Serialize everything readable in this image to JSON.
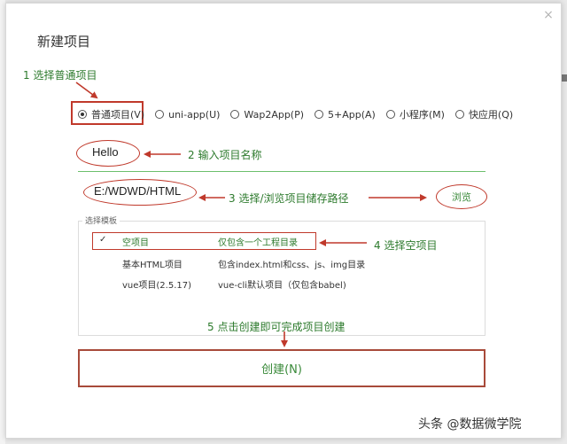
{
  "dialog": {
    "title": "新建项目",
    "close_symbol": "×"
  },
  "project_types": [
    {
      "label": "普通项目(V)",
      "checked": true
    },
    {
      "label": "uni-app(U)",
      "checked": false
    },
    {
      "label": "Wap2App(P)",
      "checked": false
    },
    {
      "label": "5+App(A)",
      "checked": false
    },
    {
      "label": "小程序(M)",
      "checked": false
    },
    {
      "label": "快应用(Q)",
      "checked": false
    }
  ],
  "form": {
    "project_name": "Hello",
    "project_path": "E:/WDWD/HTML",
    "browse_label": "浏览"
  },
  "templates": {
    "legend": "选择模板",
    "check_symbol": "✓",
    "rows": [
      {
        "name": "空项目",
        "desc": "仅包含一个工程目录",
        "selected": true
      },
      {
        "name": "基本HTML项目",
        "desc": "包含index.html和css、js、img目录",
        "selected": false
      },
      {
        "name": "vue项目(2.5.17)",
        "desc": "vue-cli默认项目（仅包含babel)",
        "selected": false
      }
    ]
  },
  "create_button": "创建(N)",
  "annotations": {
    "step1": "1   选择普通项目",
    "step2": "2    输入项目名称",
    "step3": "3    选择/浏览项目储存路径",
    "step4": "4    选择空项目",
    "step5": "5    点击创建即可完成项目创建"
  },
  "watermark": "头条 @数据微学院",
  "colors": {
    "annotation_red": "#c0392b",
    "annotation_green": "#2c7a2c",
    "accent_green": "#3a8a3a"
  }
}
